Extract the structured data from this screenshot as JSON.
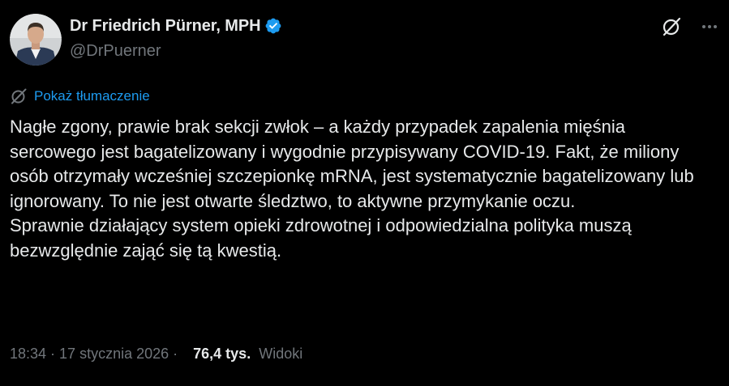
{
  "author": {
    "display_name": "Dr Friedrich Pürner, MPH",
    "handle": "@DrPuerner",
    "verified": true,
    "verified_color": "#1d9bf0"
  },
  "icons": {
    "grok": "grok-icon",
    "more": "more-icon",
    "translate": "translate-icon",
    "verified": "verified-badge-icon"
  },
  "translate": {
    "label": "Pokaż tłumaczenie"
  },
  "tweet": {
    "paragraph_1": "Nagłe zgony, prawie brak sekcji zwłok – a każdy przypadek zapalenia mięśnia sercowego jest bagatelizowany i wygodnie przypisywany COVID-19. Fakt, że miliony osób otrzymały wcześniej szczepionkę mRNA, jest systematycznie bagatelizowany lub ignorowany. To nie jest otwarte śledztwo, to aktywne przymykanie oczu.",
    "paragraph_2": "Sprawnie działający system opieki zdrowotnej i odpowiedzialna polityka muszą bezwzględnie zająć się tą kwestią."
  },
  "meta": {
    "time": "18:34",
    "date": "17 stycznia 2026",
    "separator": " · ",
    "views_count": "76,4 tys.",
    "views_label": "Widoki"
  },
  "colors": {
    "background": "#000000",
    "text": "#e7e9ea",
    "secondary": "#71767b",
    "link": "#1d9bf0"
  }
}
